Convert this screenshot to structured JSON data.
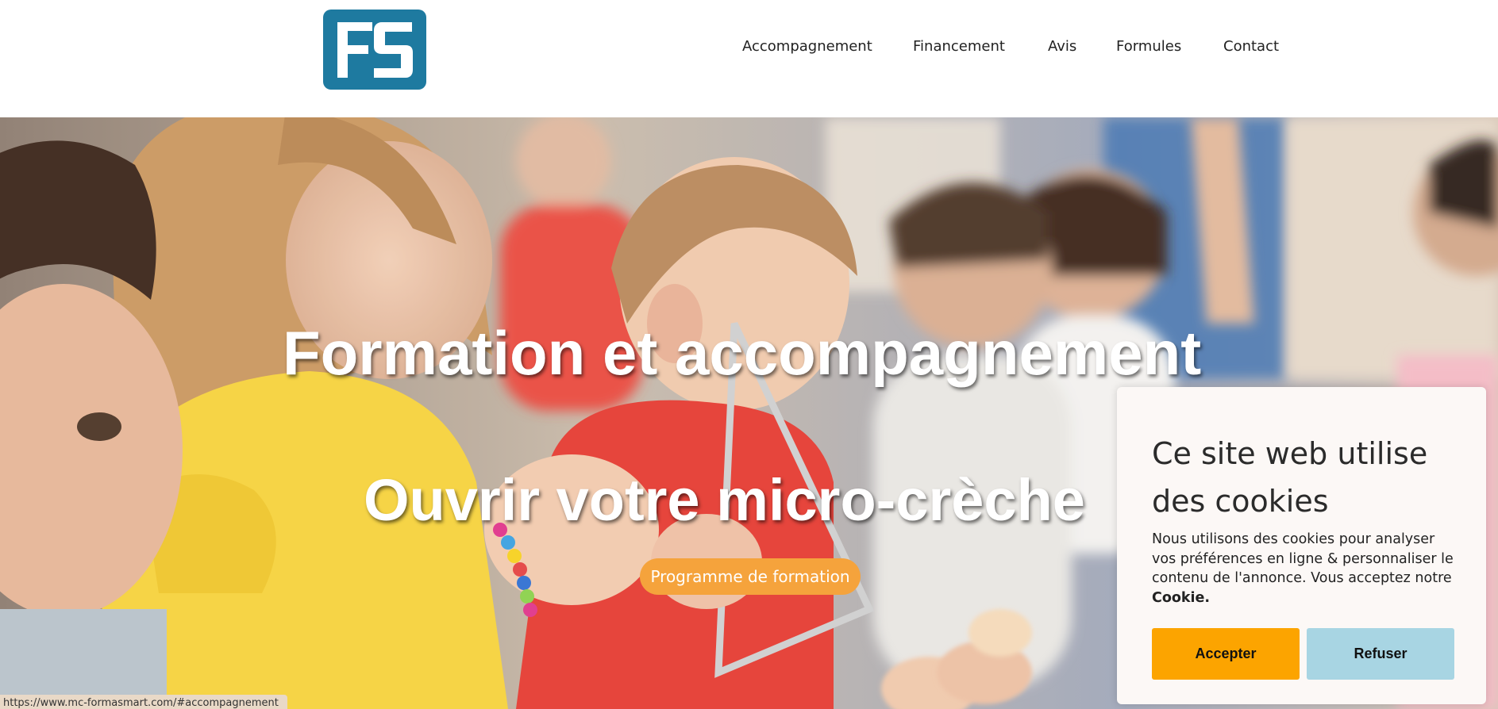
{
  "brand": {
    "logo_text": "FS",
    "logo_color": "#1e7aa0"
  },
  "nav": {
    "items": [
      {
        "label": "Accompagnement"
      },
      {
        "label": "Financement"
      },
      {
        "label": "Avis"
      },
      {
        "label": "Formules"
      },
      {
        "label": "Contact"
      }
    ]
  },
  "hero": {
    "headline": "Formation et accompagnement",
    "subheadline": "Ouvrir votre micro-crèche",
    "cta_label": "Programme de formation",
    "cta_color": "#f5a33c"
  },
  "status_bar": {
    "url": "https://www.mc-formasmart.com/#accompagnement"
  },
  "cookie_banner": {
    "title": "Ce site web utilise des cookies",
    "text": "Nous utilisons des cookies pour analyser vos préférences en ligne & personnaliser le contenu de l'annonce. Vous acceptez notre ",
    "text_bold": "Cookie.",
    "accept_label": "Accepter",
    "refuse_label": "Refuser",
    "accept_color": "#fca400",
    "refuse_color": "#a8d5e3"
  }
}
